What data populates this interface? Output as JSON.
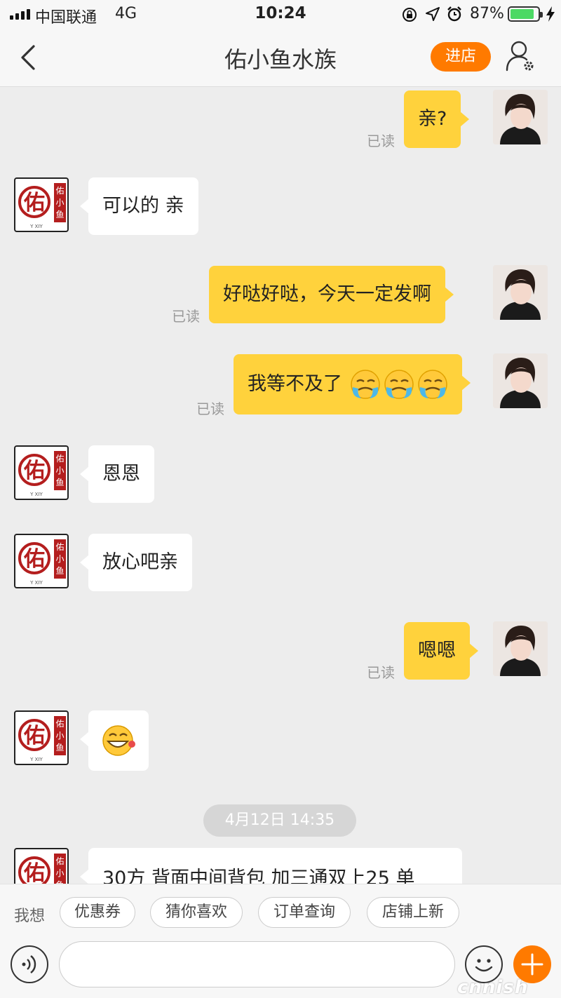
{
  "status_bar": {
    "carrier": "中国联通",
    "network": "4G",
    "time": "10:24",
    "battery_percent": "87%",
    "battery_level": 0.87,
    "icons": [
      "signal-icon",
      "orientation-lock-icon",
      "location-icon",
      "alarm-icon",
      "battery-icon",
      "charging-icon"
    ]
  },
  "nav": {
    "title": "佑小鱼水族",
    "enter_store_label": "进店",
    "icons": [
      "back-chevron-icon",
      "user-settings-icon"
    ]
  },
  "shop_logo": {
    "glyph": "佑",
    "side_text": "佑小鱼",
    "caption": "Y XIY"
  },
  "messages": [
    {
      "from": "me",
      "text": "亲?",
      "read": "已读"
    },
    {
      "from": "shop",
      "text": "可以的 亲"
    },
    {
      "from": "me",
      "text": "好哒好哒，今天一定发啊",
      "read": "已读"
    },
    {
      "from": "me",
      "text": "我等不及了",
      "emojis": [
        "crying-emoji",
        "crying-emoji",
        "crying-emoji"
      ],
      "read": "已读"
    },
    {
      "from": "shop",
      "text": "恩恩"
    },
    {
      "from": "shop",
      "text": "放心吧亲"
    },
    {
      "from": "me",
      "text": "嗯嗯",
      "read": "已读"
    },
    {
      "from": "shop",
      "text": "",
      "emojis": [
        "grinning-emoji"
      ]
    },
    {
      "timestamp": "4月12日 14:35"
    },
    {
      "from": "shop",
      "text": "30方 背面中间背包 加三通双上25 单"
    }
  ],
  "quick_bar": {
    "label": "我想",
    "chips": [
      "优惠券",
      "猜你喜欢",
      "订单查询",
      "店铺上新"
    ]
  },
  "input_bar": {
    "placeholder": "",
    "icons": [
      "voice-icon",
      "emoji-icon",
      "plus-icon"
    ]
  },
  "watermark": "cnnish",
  "colors": {
    "accent": "#ff7a00",
    "my_bubble": "#ffd23c",
    "shop_red": "#b41e1e"
  }
}
